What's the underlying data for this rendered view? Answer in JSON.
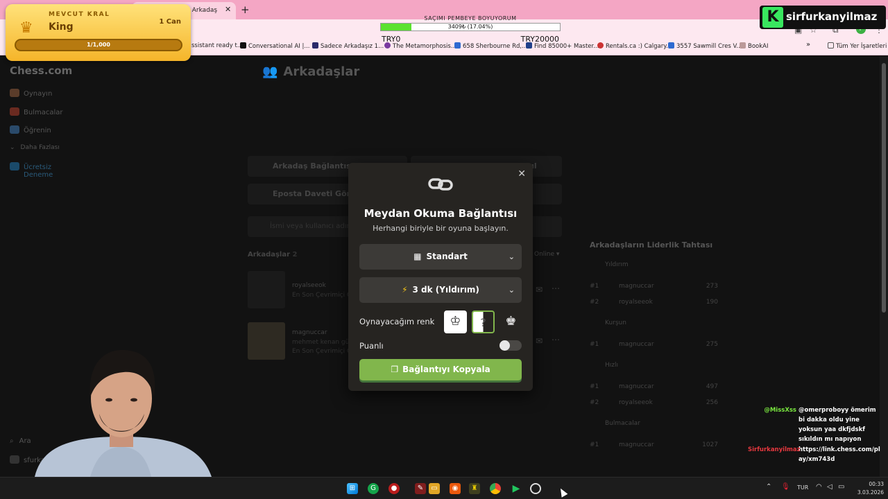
{
  "browser": {
    "active_tab": "nin Arkadaş",
    "bookmarks": [
      "ssistant ready t...",
      "Conversational AI |...",
      "Sadece Arkadaşız 1...",
      "The Metamorphosis...",
      "658 Sherbourne Rd,...",
      "Find 85000+ Master...",
      "Rentals.ca :) Calgary...",
      "3557 Sawmill Cres V...",
      "BookAI"
    ],
    "bookmarks_more": "»",
    "all_bookmarks": "Tüm Yer İşaretleri",
    "profile_initial": "F"
  },
  "overlay": {
    "king_label": "MEVCUT KRAL",
    "king_name": "King",
    "king_lives": "1 Can",
    "king_progress": "1/1,000",
    "goal_title": "SAÇIMI PEMBEYE BOYUYORUM",
    "goal_progress_text": "3409₺ (17.04%)",
    "goal_progress_fraction": 0.1704,
    "goal_min": "TRY0",
    "goal_max": "TRY20000",
    "brand_letter": "K",
    "brand_name": "sirfurkanyilmaz"
  },
  "sidebar": {
    "logo": "Chess.com",
    "items": [
      "Oynayın",
      "Bulmacalar",
      "Öğrenin",
      "Daha Fazlası",
      "Ücretsiz",
      "Deneme"
    ],
    "search": "Ara",
    "user": "sfurkanyilmaz"
  },
  "page": {
    "title": "Arkadaşlar",
    "btn_connect": "Arkadaş Bağlantısı",
    "btn_find": "ul",
    "btn_email": "Eposta Daveti Gönd",
    "search_placeholder": "İsmi veya kullanıcı adını ara",
    "friends_label": "Arkadaşlar",
    "friends_count": "2",
    "online_filter": "Online",
    "friends": [
      {
        "name": "royalseeok",
        "status": "En Son Çevrimiçi Ol"
      },
      {
        "name": "magnuccar",
        "real": "mehmet kenan gün",
        "status": "En Son Çevrimiçi Ol"
      }
    ]
  },
  "leaderboard": {
    "title": "Arkadaşların Liderlik Tahtası",
    "sections": [
      {
        "name": "Yıldırım",
        "rows": [
          [
            "#1",
            "magnuccar",
            "273"
          ],
          [
            "#2",
            "royalseeok",
            "190"
          ]
        ]
      },
      {
        "name": "Kurşun",
        "rows": [
          [
            "#1",
            "magnuccar",
            "275"
          ]
        ]
      },
      {
        "name": "Hızlı",
        "rows": [
          [
            "#1",
            "magnuccar",
            "497"
          ],
          [
            "#2",
            "royalseeok",
            "256"
          ]
        ]
      },
      {
        "name": "Bulmacalar",
        "rows": [
          [
            "#1",
            "magnuccar",
            "1027"
          ]
        ]
      }
    ]
  },
  "modal": {
    "title": "Meydan Okuma Bağlantısı",
    "subtitle": "Herhangi biriyle bir oyuna başlayın.",
    "variant": "Standart",
    "time_control": "3 dk (Yıldırım)",
    "color_label": "Oynayacağım renk",
    "random_symbol": "?",
    "rated_label": "Puanlı",
    "rated_on": false,
    "copy_button": "Bağlantıyı Kopyala"
  },
  "chat": [
    {
      "user": "@MissXss",
      "user_color": "#7ae83f",
      "text": "@omerproboyy ömerim bi dakka oldu yine yoksun yaa dkfjdskf sıkıldın mı napıyon"
    },
    {
      "user": "Sirfurkanyilmaz",
      "user_color": "#e8383f",
      "text": "https://link.chess.com/play/xm743d"
    }
  ],
  "taskbar": {
    "lang": "TUR",
    "time": "00:33",
    "date": "3.03.2026"
  }
}
